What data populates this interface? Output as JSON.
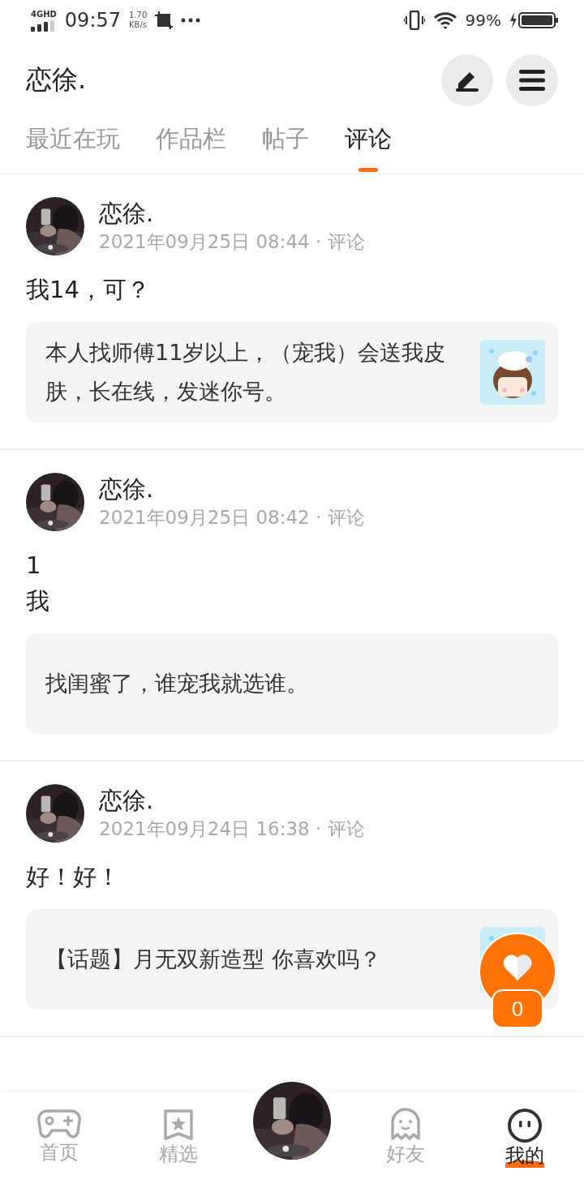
{
  "status_bar": {
    "network": "4GHD",
    "time": "09:57",
    "speed": "1.70",
    "speed_unit": "KB/s",
    "battery": "99%"
  },
  "profile": {
    "name": "恋徐."
  },
  "tabs": [
    {
      "label": "最近在玩",
      "selected": false
    },
    {
      "label": "作品栏",
      "selected": false
    },
    {
      "label": "帖子",
      "selected": false
    },
    {
      "label": "评论",
      "selected": true
    }
  ],
  "comments": [
    {
      "author": "恋徐.",
      "meta": "2021年09月25日 08:44 · 评论",
      "body": [
        "我14，可？"
      ],
      "quote": {
        "text": "本人找师傅11岁以上，（宠我）会送我皮肤，长在线，发迷你号。"
      }
    },
    {
      "author": "恋徐.",
      "meta": "2021年09月25日 08:42 · 评论",
      "body": [
        "1",
        "我"
      ],
      "quote": {
        "text": "找闺蜜了，谁宠我就选谁。"
      }
    },
    {
      "author": "恋徐.",
      "meta": "2021年09月24日 16:38 · 评论",
      "body": [
        "好！好！"
      ],
      "quote": {
        "text": "【话题】月无双新造型 你喜欢吗？"
      }
    }
  ],
  "like": {
    "count": "0"
  },
  "nav": [
    {
      "kind": "tab",
      "label": "首页",
      "selected": false
    },
    {
      "kind": "tab",
      "label": "精选",
      "selected": false
    },
    {
      "kind": "avatar"
    },
    {
      "kind": "tab",
      "label": "好友",
      "selected": false
    },
    {
      "kind": "tab",
      "label": "我的",
      "selected": true
    }
  ]
}
